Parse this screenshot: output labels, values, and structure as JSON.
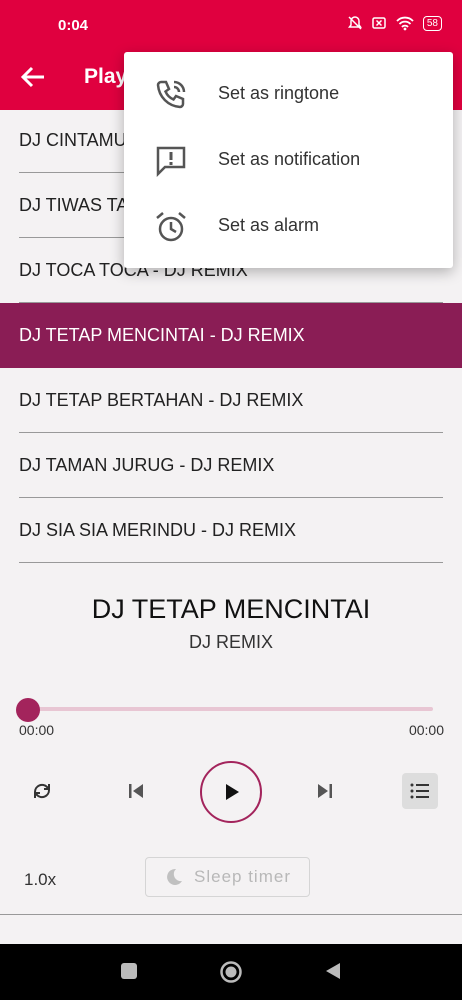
{
  "status": {
    "time": "0:04",
    "battery": "58"
  },
  "appbar": {
    "title": "Playlist"
  },
  "playlist": {
    "items": [
      {
        "label": "DJ CINTAMU SEPAHIT TOPI MIRING - DJ REMIX",
        "selected": false
      },
      {
        "label": "DJ TIWAS TAK GONDELI TENANAN - DJ REMIX",
        "selected": false
      },
      {
        "label": "DJ TOCA TOCA - DJ REMIX",
        "selected": false
      },
      {
        "label": "DJ TETAP MENCINTAI - DJ REMIX",
        "selected": true
      },
      {
        "label": "DJ TETAP BERTAHAN - DJ REMIX",
        "selected": false
      },
      {
        "label": "DJ TAMAN JURUG - DJ REMIX",
        "selected": false
      },
      {
        "label": "DJ SIA SIA MERINDU - DJ REMIX",
        "selected": false
      }
    ]
  },
  "now_playing": {
    "title": "DJ TETAP MENCINTAI",
    "artist": "DJ REMIX"
  },
  "progress": {
    "current": "00:00",
    "total": "00:00",
    "fraction": 0
  },
  "footer": {
    "speed": "1.0x",
    "sleep_label": "Sleep timer"
  },
  "menu": {
    "items": [
      {
        "label": "Set as ringtone",
        "icon": "phone-ringing-icon"
      },
      {
        "label": "Set as notification",
        "icon": "notification-icon"
      },
      {
        "label": "Set as alarm",
        "icon": "alarm-icon"
      }
    ]
  },
  "colors": {
    "primary": "#e0003f",
    "selected": "#8a1d55",
    "accent": "#a3245c"
  }
}
